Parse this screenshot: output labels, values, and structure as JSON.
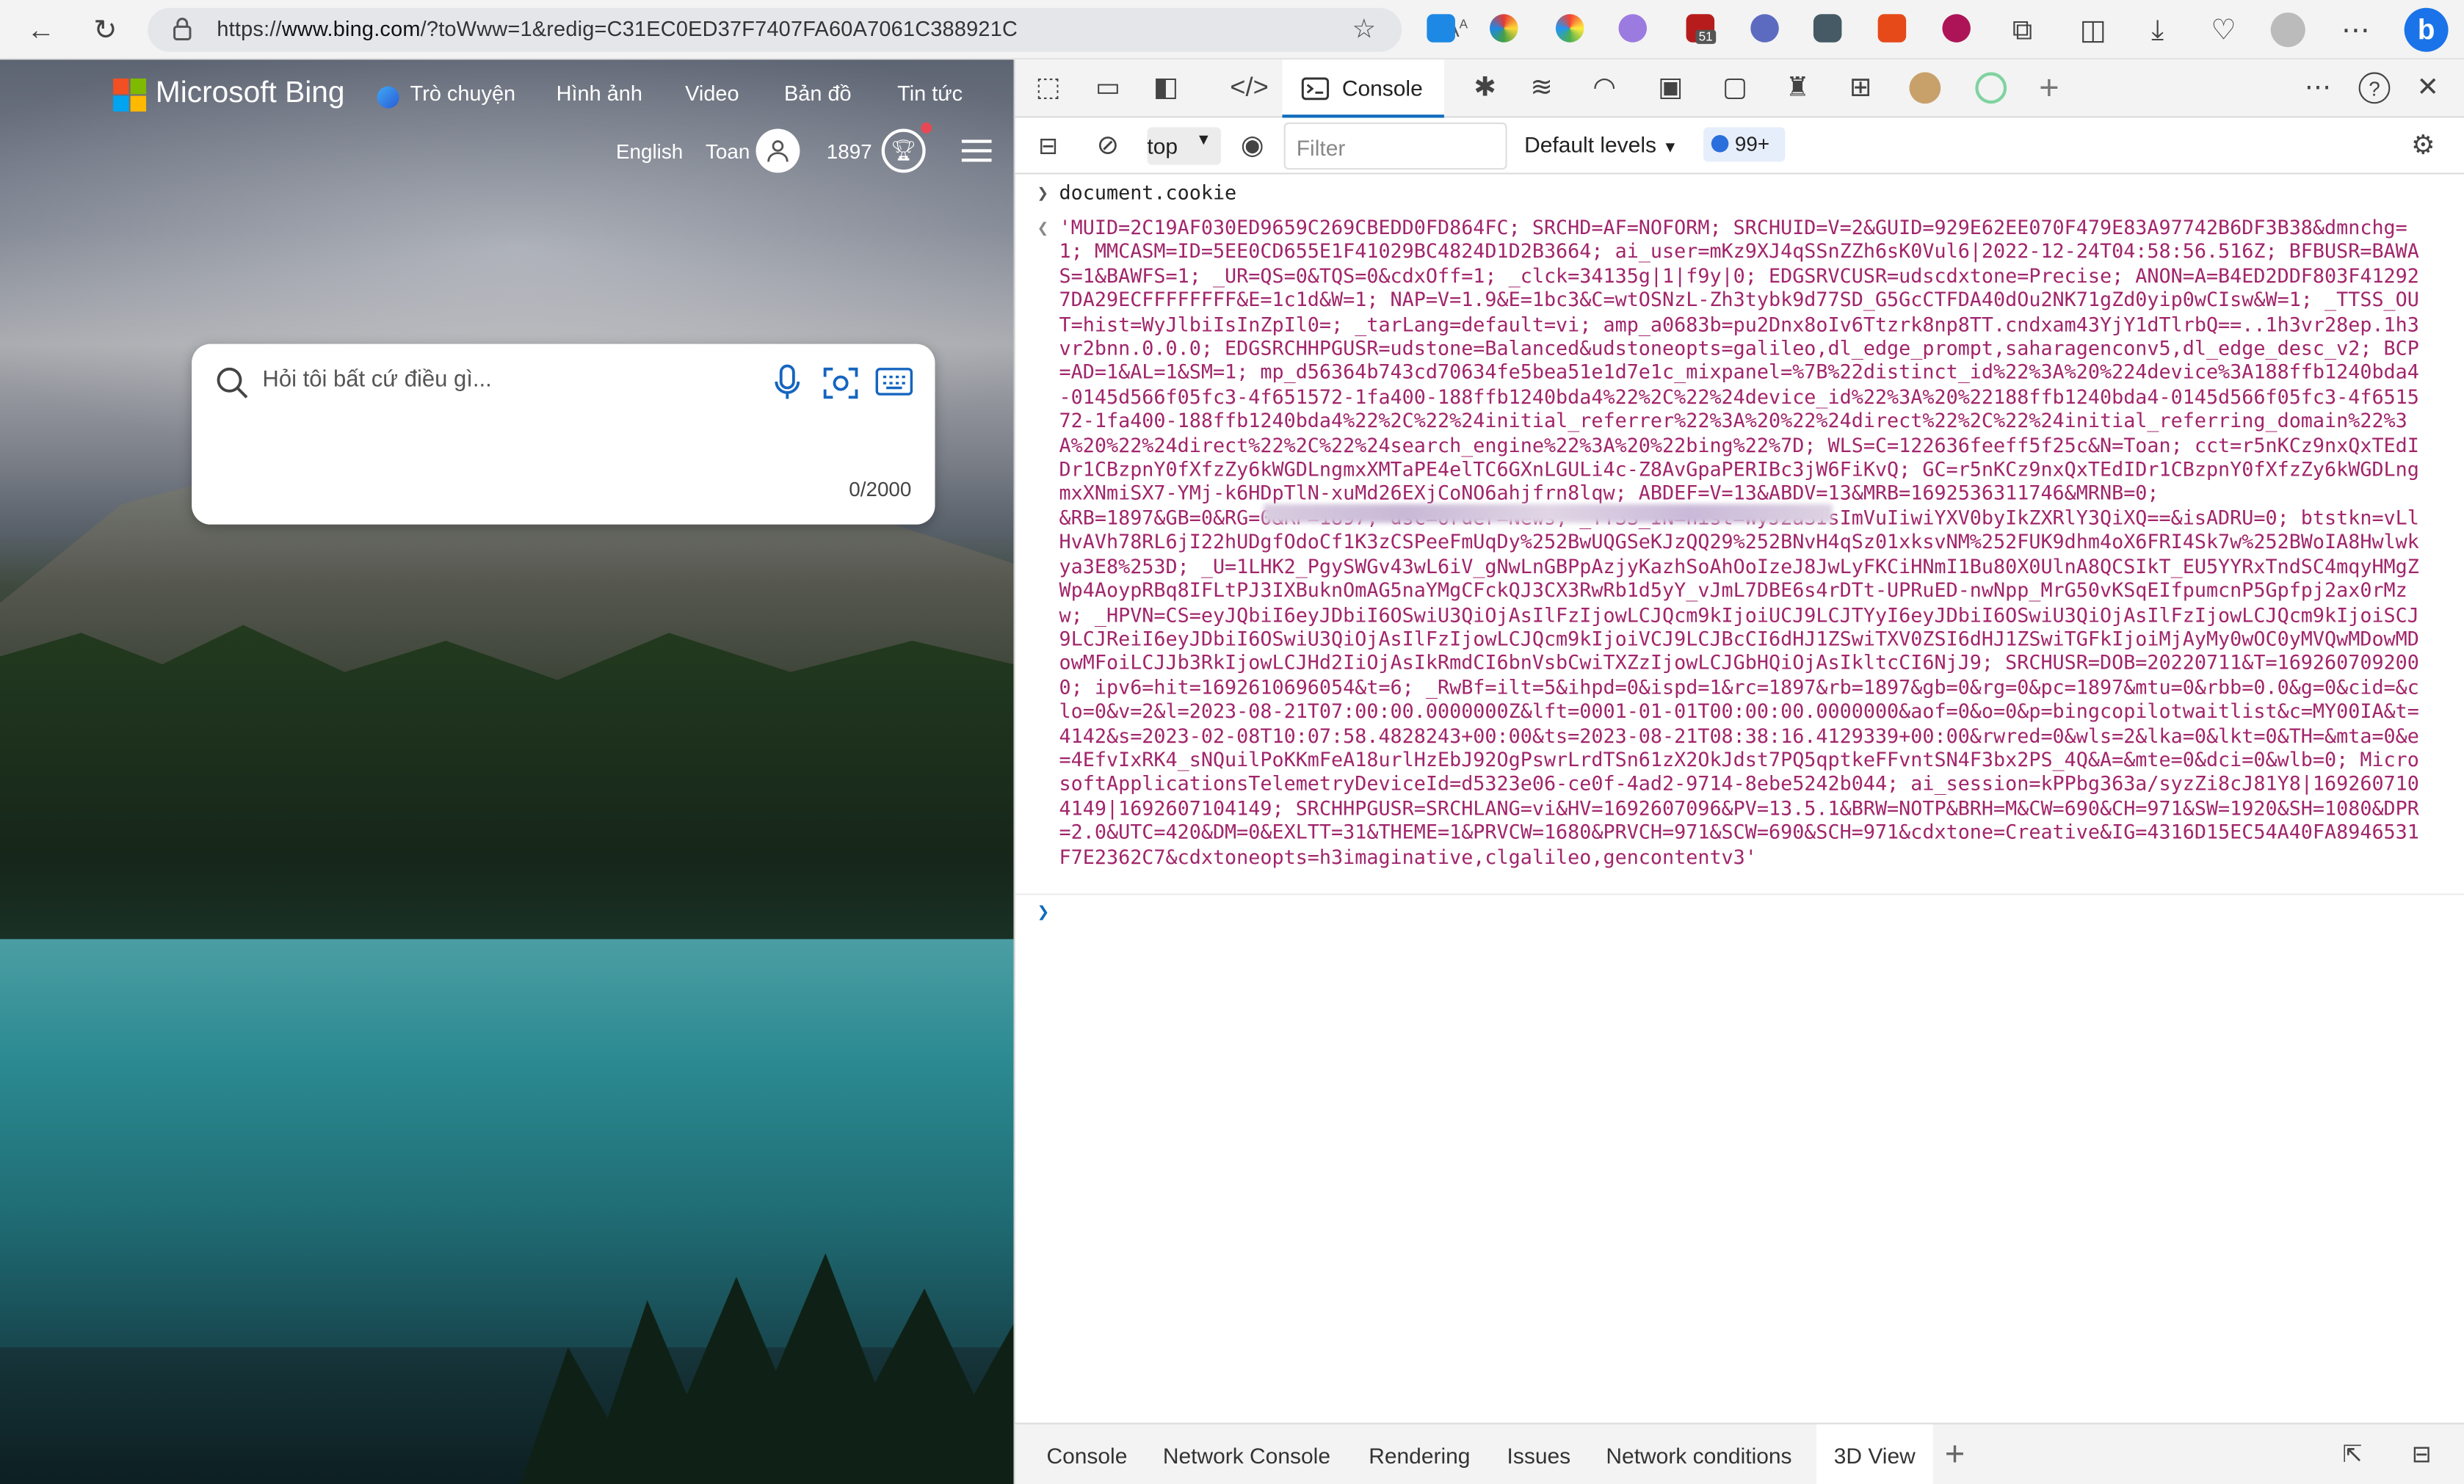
{
  "browser": {
    "url_prefix": "https://",
    "url_host": "www.bing.com",
    "url_rest": "/?toWww=1&redig=C31EC0ED37F7407FA60A7061C388921C",
    "read_aloud": "A",
    "ext_badge": "51"
  },
  "bing": {
    "logo": "Microsoft Bing",
    "nav": [
      "Trò chuyện",
      "Hình ảnh",
      "Video",
      "Bản đồ",
      "Tin tức"
    ],
    "language": "English",
    "user": "Toan",
    "points": "1897",
    "search_placeholder": "Hỏi tôi bất cứ điều gì...",
    "char_count": "0/2000"
  },
  "devtools": {
    "active_tab": "Console",
    "context": "top",
    "filter_placeholder": "Filter",
    "levels": "Default levels",
    "issues_count": "99+",
    "command": "document.cookie",
    "output": "'MUID=2C19AF030ED9659C269CBEDD0FD864FC; SRCHD=AF=NOFORM; SRCHUID=V=2&GUID=929E62EE070F479E83A97742B6DF3B38&dmnchg=1; MMCASM=ID=5EE0CD655E1F41029BC4824D1D2B3664; ai_user=mKz9XJ4qSSnZZh6sK0Vul6|2022-12-24T04:58:56.516Z; BFBUSR=BAWAS=1&BAWFS=1; _UR=QS=0&TQS=0&cdxOff=1; _clck=34135g|1|f9y|0; EDGSRVCUSR=udscdxtone=Precise; ANON=A=B4ED2DDF803F412927DA29ECFFFFFFFF&E=1c1d&W=1; NAP=V=1.9&E=1bc3&C=wtOSNzL-Zh3tybk9d77SD_G5GcCTFDA40dOu2NK71gZd0yip0wCIsw&W=1; _TTSS_OUT=hist=WyJlbiIsInZpIl0=; _tarLang=default=vi; amp_a0683b=pu2Dnx8oIv6Ttzrk8np8TT.cndxam43YjY1dTlrbQ==..1h3vr28ep.1h3vr2bnn.0.0.0; EDGSRCHHPGUSR=udstone=Balanced&udstoneopts=galileo,dl_edge_prompt,saharagenconv5,dl_edge_desc_v2; BCP=AD=1&AL=1&SM=1; mp_d56364b743cd70634fe5bea51e1d7e1c_mixpanel=%7B%22distinct_id%22%3A%20%224device%3A188ffb1240bda4-0145d566f05fc3-4f651572-1fa400-188ffb1240bda4%22%2C%22%24device_id%22%3A%20%22188ffb1240bda4-0145d566f05fc3-4f651572-1fa400-188ffb1240bda4%22%2C%22%24initial_referrer%22%3A%20%22%24direct%22%2C%22%24initial_referring_domain%22%3A%20%22%24direct%22%2C%22%24search_engine%22%3A%20%22bing%22%7D; WLS=C=122636feeff5f25c&N=Toan; cct=r5nKCz9nxQxTEdIDr1CBzpnY0fXfzZy6kWGDLngmxXMTaPE4elTC6GXnLGULi4c-Z8AvGpaPERIBc3jW6FiKvQ; GC=r5nKCz9nxQxTEdIDr1CBzpnY0fXfzZy6kWGDLngmxXNmiSX7-YMj-k6HDpTlN-xuMd26EXjCoNO6ahjfrn8lqw; ABDEF=V=13&ABDV=13&MRB=1692536311746&MRNB=0;                                                  &RB=1897&GB=0&RG=0&RP=1897; dsc=order=News; _TTSS_IN=hist=WyJ2aSIsImVuIiwiYXV0byIkZXRlY3QiXQ==&isADRU=0; btstkn=vLlHvAVh78RL6jI22hUDgfOdoCf1K3zCSPeeFmUqDy%252BwUQGSeKJzQQ29%252BNvH4qSz01xksvNM%252FUK9dhm4oX6FRI4Sk7w%252BWoIA8Hwlwkya3E8%253D; _U=1LHK2_PgySWGv43wL6iV_gNwLnGBPpAzjyKazhSoAhOoIzeJ8JwLyFKCiHNmI1Bu80X0UlnA8QCSIkT_EU5YYRxTndSC4mqyHMgZWp4AoypRBq8IFLtPJ3IXBuknOmAG5naYMgCFckQJ3CX3RwRb1d5yY_vJmL7DBE6s4rDTt-UPRuED-nwNpp_MrG50vKSqEIfpumcnP5Gpfpj2ax0rMzw; _HPVN=CS=eyJQbiI6eyJDbiI6OSwiU3QiOjAsIlFzIjowLCJQcm9kIjoiUCJ9LCJTYyI6eyJDbiI6OSwiU3QiOjAsIlFzIjowLCJQcm9kIjoiSCJ9LCJReiI6eyJDbiI6OSwiU3QiOjAsIlFzIjowLCJQcm9kIjoiVCJ9LCJBcCI6dHJ1ZSwiTXV0ZSI6dHJ1ZSwiTGFkIjoiMjAyMy0wOC0yMVQwMDowMDowMFoiLCJJb3RkIjowLCJHd2IiOjAsIkRmdCI6bnVsbCwiTXZzIjowLCJGbHQiOjAsIkltcCI6NjJ9; SRCHUSR=DOB=20220711&T=1692607092000; ipv6=hit=1692610696054&t=6; _RwBf=ilt=5&ihpd=0&ispd=1&rc=1897&rb=1897&gb=0&rg=0&pc=1897&mtu=0&rbb=0.0&g=0&cid=&clo=0&v=2&l=2023-08-21T07:00:00.0000000Z&lft=0001-01-01T00:00:00.0000000&aof=0&o=0&p=bingcopilotwaitlist&c=MY00IA&t=4142&s=2023-02-08T10:07:58.4828243+00:00&ts=2023-08-21T08:38:16.4129339+00:00&rwred=0&wls=2&lka=0&lkt=0&TH=&mta=0&e=4EfvIxRK4_sNQuilPoKKmFeA18urlHzEbJ92OgPswrLrdTSn61zX2OkJdst7PQ5qptkeFFvntSN4F3bx2PS_4Q&A=&mte=0&dci=0&wlb=0; MicrosoftApplicationsTelemetryDeviceId=d5323e06-ce0f-4ad2-9714-8ebe5242b044; ai_session=kPPbg363a/syzZi8cJ81Y8|1692607104149|1692607104149; SRCHHPGUSR=SRCHLANG=vi&HV=1692607096&PV=13.5.1&BRW=NOTP&BRH=M&CW=690&CH=971&SW=1920&SH=1080&DPR=2.0&UTC=420&DM=0&EXLTT=31&THEME=1&PRVCW=1680&PRVCH=971&SCW=690&SCH=971&cdxtone=Creative&IG=4316D15EC54A40FA8946531F7E2362C7&cdxtoneopts=h3imaginative,clgalileo,gencontentv3'",
    "drawer_tabs": [
      "Console",
      "Network Console",
      "Rendering",
      "Issues",
      "Network conditions",
      "3D View"
    ]
  },
  "colors": {
    "accent": "#0f6cbd",
    "string": "#a1256b",
    "ms_red": "#f25022",
    "ms_green": "#7fba00",
    "ms_blue": "#00a4ef",
    "ms_yellow": "#ffb900"
  }
}
